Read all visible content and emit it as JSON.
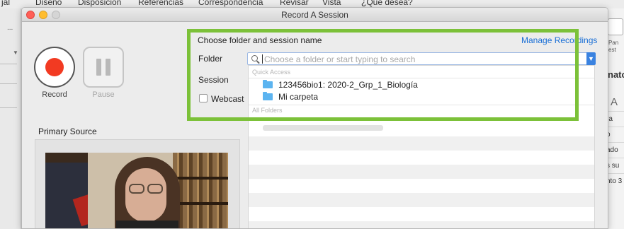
{
  "background_app": {
    "menu_items": [
      "jal",
      "Diseño",
      "Disposición",
      "Referencias",
      "Correspondencia",
      "Revisar",
      "Vista",
      "¿Qué desea?"
    ],
    "left_dots": "...",
    "right_panel": {
      "pane_label_1": "Pan",
      "pane_label_2": "est",
      "heading": "nato",
      "cells": [
        "ra",
        "o",
        "ado",
        "s su",
        "nto 3"
      ]
    }
  },
  "dialog": {
    "title": "Record A Session",
    "record": {
      "label": "Record"
    },
    "pause": {
      "label": "Pause"
    },
    "primary_source": {
      "title": "Primary Source"
    },
    "form": {
      "heading": "Choose folder and session name",
      "manage_link": "Manage Recordings",
      "folder_label": "Folder",
      "folder_placeholder": "Choose a folder or start typing to search",
      "session_label": "Session",
      "webcast_label": "Webcast",
      "webcast_checked": false
    },
    "dropdown": {
      "quick_access_header": "Quick Access",
      "quick_access_items": [
        {
          "label": "123456bio1: 2020-2_Grp_1_Biología",
          "icon": "folder-icon"
        },
        {
          "label": "Mi carpeta",
          "icon": "folder-icon"
        }
      ],
      "all_folders_header": "All Folders"
    },
    "colors": {
      "record_red": "#f23a22",
      "link_blue": "#1a6fd6",
      "highlight_green": "#7cc139",
      "folder_blue": "#5cb4f0"
    }
  }
}
